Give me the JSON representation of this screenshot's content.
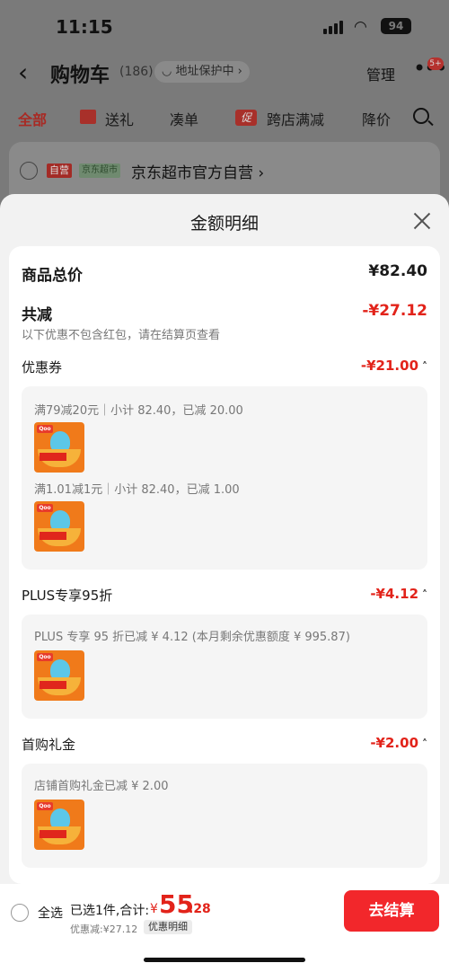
{
  "status": {
    "time": "11:15",
    "battery": "94"
  },
  "nav": {
    "title": "购物车",
    "count": "(186)",
    "protect": "◡ 地址保护中 ›",
    "manage": "管理",
    "badge": "5+"
  },
  "filters": {
    "all": "全部",
    "gift": "送礼",
    "coudan": "凑单",
    "cu": "促",
    "cross": "跨店满减",
    "price_drop": "降价"
  },
  "store": {
    "self": "自营",
    "tag": "京东超市",
    "name": "京东超市官方自营 ›"
  },
  "sheet": {
    "title": "金额明细",
    "total_label": "商品总价",
    "total_value": "¥82.40",
    "reduce_label": "共减",
    "reduce_value": "-¥27.12",
    "note": "以下优惠不包含红包，请在结算页查看",
    "coupon": {
      "label": "优惠券",
      "value": "-¥21.00",
      "lines": [
        "满79减20元｜小计 82.40，已减 20.00",
        "满1.01减1元｜小计 82.40，已减 1.00"
      ]
    },
    "plus": {
      "label": "PLUS专享95折",
      "value": "-¥4.12",
      "line": "PLUS 专享 95 折已减 ¥ 4.12 (本月剩余优惠额度 ¥ 995.87)"
    },
    "first": {
      "label": "首购礼金",
      "value": "-¥2.00",
      "line": "店铺首购礼金已减 ¥ 2.00"
    },
    "thumb_logo": "Qoo"
  },
  "bottom": {
    "select_all": "全选",
    "selected": "已选1件,合计:",
    "currency": "¥",
    "amount_int": "55",
    "amount_dec": ".28",
    "discount": "优惠减:¥27.12",
    "detail": "优惠明细",
    "checkout": "去结算"
  },
  "colors": {
    "accent": "#e2231a",
    "checkout": "#f2272b"
  }
}
